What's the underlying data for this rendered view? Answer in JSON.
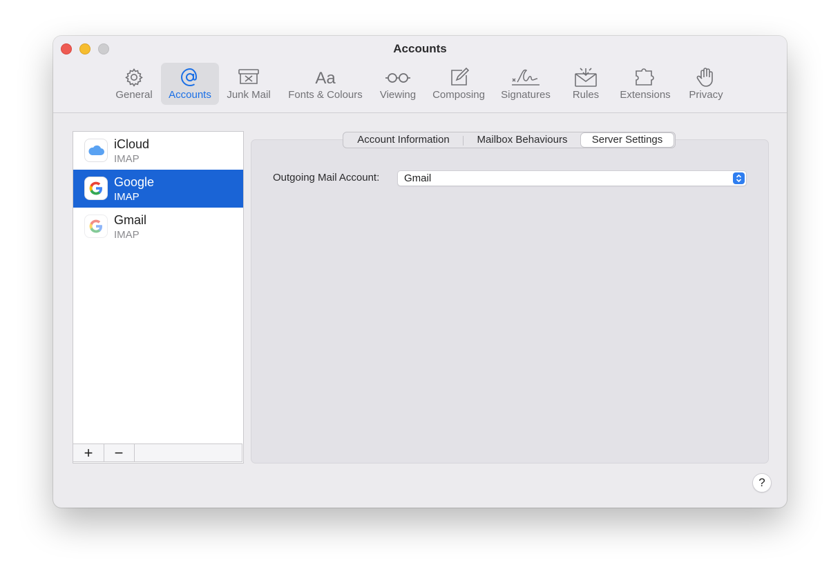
{
  "window": {
    "title": "Accounts"
  },
  "toolbar": {
    "items": [
      {
        "label": "General",
        "icon": "gear-icon"
      },
      {
        "label": "Accounts",
        "icon": "at-sign-icon",
        "active": true
      },
      {
        "label": "Junk Mail",
        "icon": "junk-tray-icon"
      },
      {
        "label": "Fonts & Colours",
        "icon": "font-aa-icon"
      },
      {
        "label": "Viewing",
        "icon": "glasses-icon"
      },
      {
        "label": "Composing",
        "icon": "compose-icon"
      },
      {
        "label": "Signatures",
        "icon": "signature-icon"
      },
      {
        "label": "Rules",
        "icon": "rules-envelope-icon"
      },
      {
        "label": "Extensions",
        "icon": "puzzle-icon"
      },
      {
        "label": "Privacy",
        "icon": "hand-icon"
      }
    ]
  },
  "accounts": [
    {
      "name": "iCloud",
      "type": "IMAP",
      "icon": "icloud-icon"
    },
    {
      "name": "Google",
      "type": "IMAP",
      "icon": "google-g-icon",
      "selected": true
    },
    {
      "name": "Gmail",
      "type": "IMAP",
      "icon": "google-g-icon"
    }
  ],
  "list_footer": {
    "add": "+",
    "remove": "−"
  },
  "tabs": [
    {
      "label": "Account Information"
    },
    {
      "label": "Mailbox Behaviours"
    },
    {
      "label": "Server Settings",
      "active": true
    }
  ],
  "server_settings": {
    "outgoing_label": "Outgoing Mail Account:",
    "outgoing_value": "Gmail"
  },
  "help": "?",
  "colors": {
    "accent": "#1a6fe6",
    "selection": "#1a64d6"
  }
}
